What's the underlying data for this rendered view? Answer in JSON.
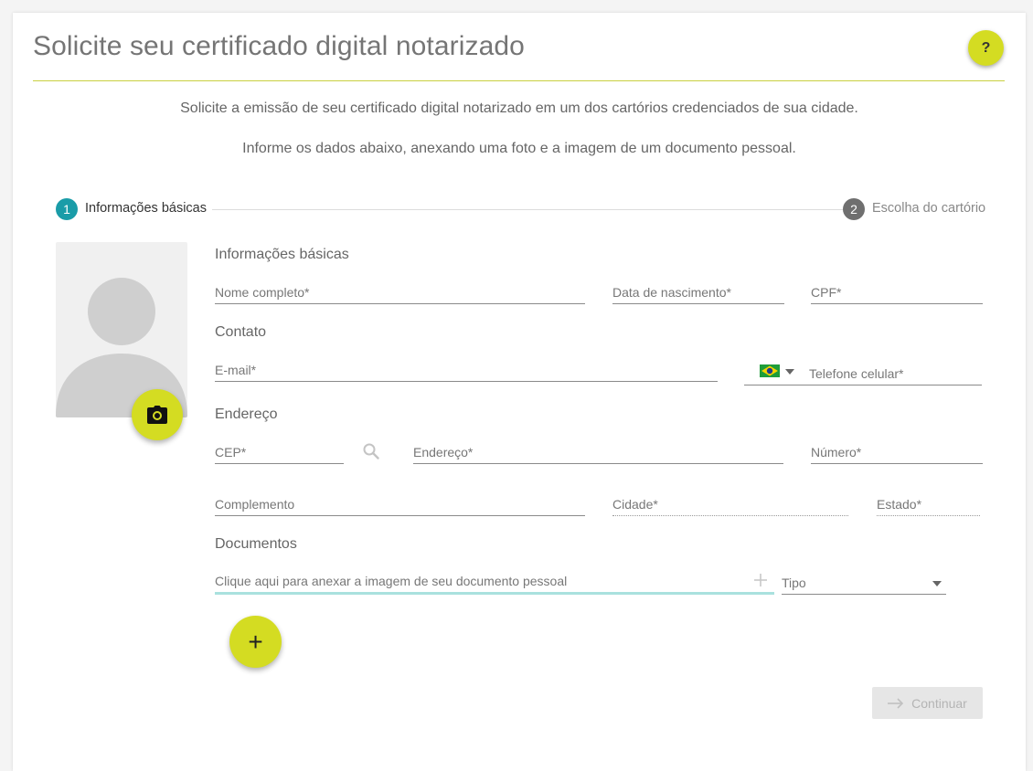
{
  "header": {
    "title": "Solicite seu certificado digital notarizado",
    "help_label": "?"
  },
  "intro": {
    "line1": "Solicite a emissão de seu certificado digital notarizado em um dos cartórios credenciados de sua cidade.",
    "line2": "Informe os dados abaixo, anexando uma foto e a imagem de um documento pessoal."
  },
  "stepper": {
    "steps": [
      {
        "number": "1",
        "label": "Informações básicas",
        "state": "active"
      },
      {
        "number": "2",
        "label": "Escolha do cartório",
        "state": "inactive"
      }
    ]
  },
  "form": {
    "basic": {
      "title": "Informações básicas",
      "name_label": "Nome completo*",
      "birth_label": "Data de nascimento*",
      "cpf_label": "CPF*"
    },
    "contact": {
      "title": "Contato",
      "email_label": "E-mail*",
      "phone_label": "Telefone celular*",
      "country_flag": "brazil-flag"
    },
    "address": {
      "title": "Endereço",
      "cep_label": "CEP*",
      "address_label": "Endereço*",
      "number_label": "Número*",
      "complement_label": "Complemento",
      "city_label": "Cidade*",
      "state_label": "Estado*"
    },
    "documents": {
      "title": "Documentos",
      "attach_label": "Clique aqui para anexar a imagem de seu documento pessoal",
      "type_label": "Tipo",
      "add_label": "+"
    }
  },
  "actions": {
    "continue_label": "Continuar"
  },
  "colors": {
    "accent": "#d4dc22",
    "step_active": "#1a9ca8",
    "step_inactive": "#6f6f6f",
    "attach_underline": "#a9e1de"
  }
}
